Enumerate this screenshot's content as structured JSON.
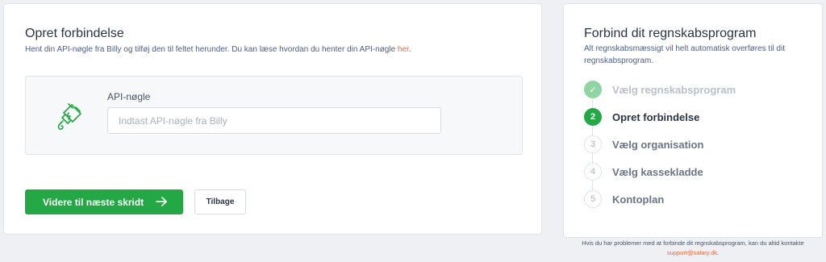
{
  "connection": {
    "title": "Opret forbindelse",
    "subtitle_prefix": "Hent din API-nøgle fra Billy og tilføj den til feltet herunder. Du kan læse hvordan du henter din API-nøgle ",
    "subtitle_link": "her",
    "subtitle_suffix": ".",
    "plug_icon": "plug-icon",
    "field_label": "API-nøgle",
    "field_value": "",
    "field_placeholder": "Indtast API-nøgle fra Billy",
    "next_button_label": "Videre til næste skridt",
    "next_button_icon": "arrow-right-icon",
    "back_button_label": "Tilbage"
  },
  "wizard": {
    "title": "Forbind dit regnskabsprogram",
    "description": "Alt regnskabsmæssigt vil helt automatisk overføres til dit regnskabsprogram.",
    "steps": [
      {
        "number": "✓",
        "label": "Vælg regnskabsprogram",
        "state": "done"
      },
      {
        "number": "2",
        "label": "Opret forbindelse",
        "state": "active"
      },
      {
        "number": "3",
        "label": "Vælg organisation",
        "state": "todo"
      },
      {
        "number": "4",
        "label": "Vælg kassekladde",
        "state": "todo"
      },
      {
        "number": "5",
        "label": "Kontoplan",
        "state": "todo"
      }
    ]
  },
  "footer": {
    "note": "Hvis du har problemer med at forbinde dit regnskabsprogram, kan du altid kontakte",
    "email": "support@salary.dk",
    "email_suffix": "."
  },
  "colors": {
    "accent_green": "#23a845",
    "done_green": "#8fd4a3",
    "link_orange": "#e86a3c",
    "text_dark": "#2b3445",
    "text_blue_gray": "#4a5f8c",
    "page_bg": "#eef0f4"
  }
}
